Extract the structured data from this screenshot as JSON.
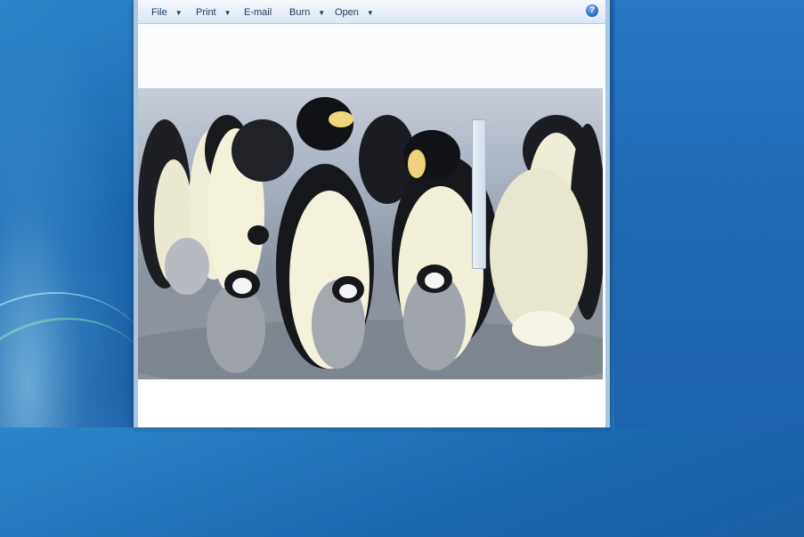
{
  "window": {
    "toolbar": {
      "file": "File",
      "print": "Print",
      "email": "E-mail",
      "burn": "Burn",
      "open": "Open",
      "help": "?"
    },
    "photo": {
      "subject": "Emperor penguins with chicks"
    }
  }
}
